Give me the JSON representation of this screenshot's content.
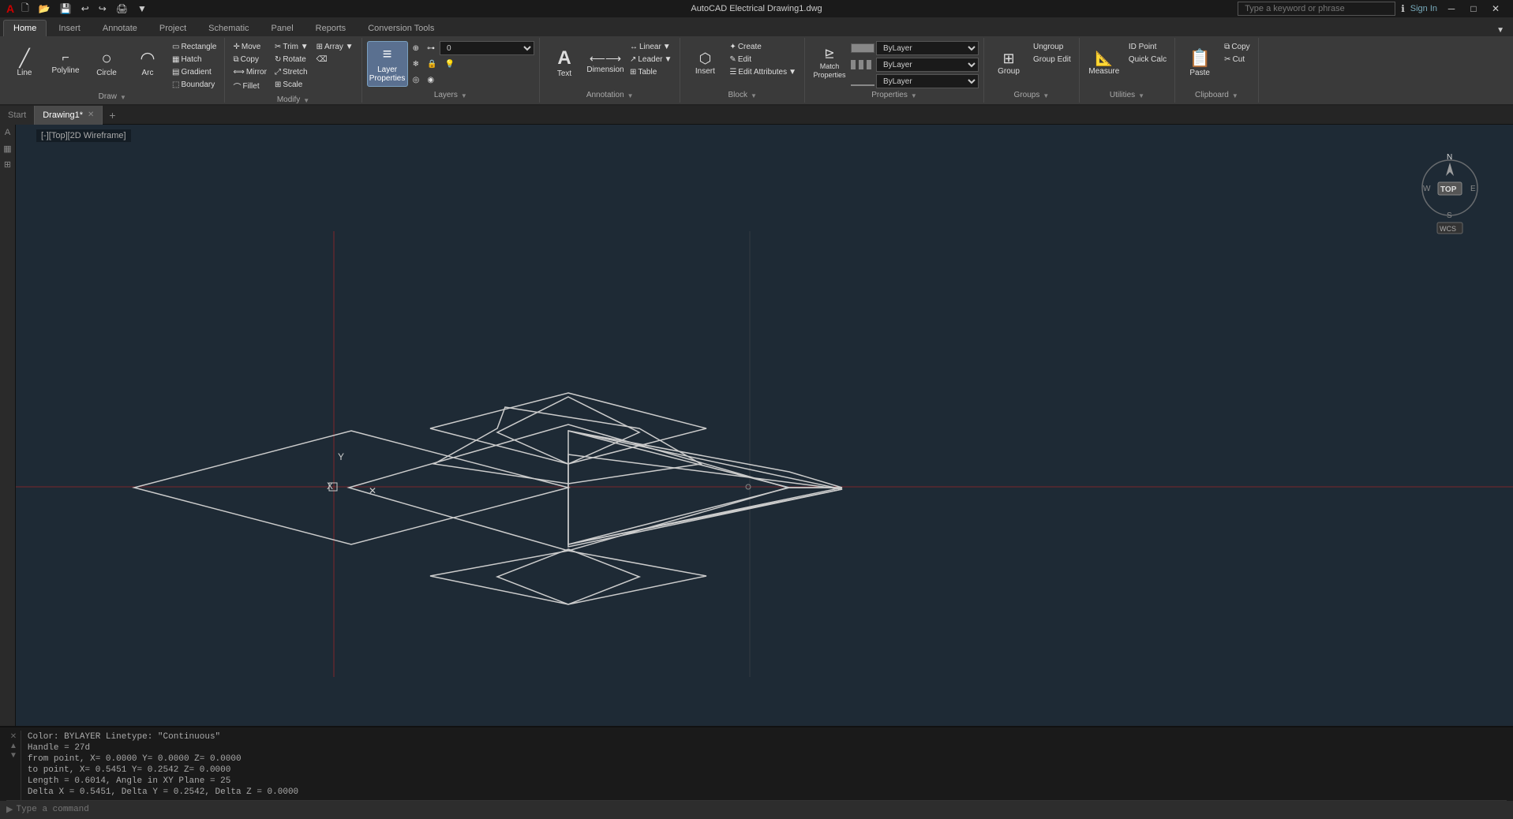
{
  "title": {
    "app": "AutoCAD Electrical",
    "file": "Drawing1.dwg",
    "full": "AutoCAD Electrical    Drawing1.dwg"
  },
  "titlebar": {
    "app_icon": "A",
    "quick_access": [
      "save",
      "undo",
      "redo",
      "open",
      "new"
    ],
    "search_placeholder": "Type a keyword or phrase",
    "sign_in": "Sign In",
    "minimize": "─",
    "maximize": "□",
    "close": "✕"
  },
  "ribbon": {
    "tabs": [
      "Home",
      "Insert",
      "Annotate",
      "Project",
      "Schematic",
      "Panel",
      "Reports",
      "Conversion Tools"
    ],
    "active_tab": "Home",
    "groups": {
      "draw": {
        "label": "Draw",
        "buttons": {
          "line": "Line",
          "polyline": "Polyline",
          "circle": "Circle",
          "arc": "Arc"
        }
      },
      "modify": {
        "label": "Modify",
        "buttons": {
          "move": "Move",
          "copy": "Copy",
          "mirror": "Mirror",
          "fillet": "Fillet",
          "trim": "Trim",
          "rotate": "Rotate",
          "stretch": "Stretch",
          "scale": "Scale",
          "array": "Array",
          "erase": "Erase"
        }
      },
      "layers": {
        "label": "Layers",
        "layer_props": "Layer Properties",
        "make_current": "Make Current",
        "match_layer": "Match Layer",
        "current_layer": "0",
        "layer_combo_value": "0"
      },
      "annotation": {
        "label": "Annotation",
        "text": "Text",
        "dimension": "Dimension",
        "leader": "Leader",
        "table": "Table",
        "linear": "Linear"
      },
      "block": {
        "label": "Block",
        "insert": "Insert",
        "create": "Create",
        "edit": "Edit",
        "edit_attributes": "Edit Attributes"
      },
      "properties": {
        "label": "Properties",
        "match_props": "Match Properties",
        "bylayer": "ByLayer",
        "bylayer2": "ByLayer",
        "bylayer3": "ByLayer",
        "color_line": "——————",
        "lineweight_label": "ByLayer"
      },
      "groups_group": {
        "label": "Groups",
        "group": "Group"
      },
      "utilities": {
        "label": "Utilities",
        "measure": "Measure"
      },
      "clipboard": {
        "label": "Clipboard",
        "paste": "Paste",
        "copy": "Copy"
      }
    }
  },
  "doc_tabs": {
    "start": "Start",
    "drawing": "Drawing1*",
    "add": "+"
  },
  "canvas": {
    "label": "[-][Top][2D Wireframe]",
    "background": "#1e2a35"
  },
  "compass": {
    "n": "N",
    "s": "S",
    "e": "E",
    "w": "W",
    "top": "TOP",
    "wcs": "WCS"
  },
  "command_line": {
    "lines": [
      "Color: BYLAYER    Linetype: \"Continuous\"",
      "Handle = 27d",
      "from point, X=   0.0000  Y=   0.0000  Z=   0.0000",
      "  to point, X=   0.5451  Y=   0.2542  Z=   0.0000",
      "Length =   0.6014,  Angle in XY Plane =    25",
      "  Delta X =   0.5451, Delta Y =    0.2542, Delta Z =   0.0000"
    ],
    "prompt": "Type a command",
    "prompt_symbol": "▶"
  }
}
